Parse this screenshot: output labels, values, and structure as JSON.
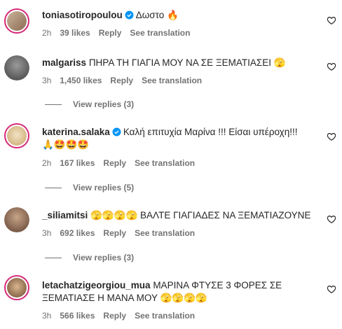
{
  "comments": [
    {
      "username": "toniasotiropoulou",
      "verified": true,
      "text": "Δωστο 🔥",
      "time": "2h",
      "likes": "39 likes",
      "reply": "Reply",
      "translate": "See translation"
    },
    {
      "username": "malgariss",
      "verified": false,
      "text": "ΠΗΡΑ ΤΗ ΓΙΑΓΙΑ ΜΟΥ ΝΑ ΣΕ ΞΕΜΑΤΙΑΣΕΙ 🫣",
      "time": "3h",
      "likes": "1,450 likes",
      "reply": "Reply",
      "translate": "See translation",
      "view_replies": "View replies (3)"
    },
    {
      "username": "katerina.salaka",
      "verified": true,
      "text": "Καλή επιτυχία Μαρίνα !!! Είσαι υπέροχη!!!",
      "text2": "🙏🤩🤩🤩",
      "time": "2h",
      "likes": "167 likes",
      "reply": "Reply",
      "translate": "See translation",
      "view_replies": "View replies (5)"
    },
    {
      "username": "_siliamitsi",
      "verified": false,
      "text": "🫣🫣🫣🫣 ΒΑΛΤΕ ΓΙΑΓΙΑΔΕΣ ΝΑ ΞΕΜΑΤΙΑΖΟΥΝΕ",
      "time": "3h",
      "likes": "692 likes",
      "reply": "Reply",
      "translate": "See translation",
      "view_replies": "View replies (3)"
    },
    {
      "username": "letachatzigeorgiou_mua",
      "verified": false,
      "text": "ΜΑΡΙΝΑ ΦΤΥΣΕ 3 ΦΟΡΕΣ ΣΕ",
      "text2": "ΞΕΜΑΤΙΑΣΕ Η ΜΑΝΑ ΜΟΥ 🫣🫣🫣🫣",
      "time": "3h",
      "likes": "566 likes",
      "reply": "Reply",
      "translate": "See translation"
    }
  ],
  "colors": {
    "meta": "#737373",
    "verified": "#0095f6",
    "ring": "#d62976"
  },
  "icons": {
    "like": "heart-icon",
    "verified": "verified-badge-icon"
  }
}
